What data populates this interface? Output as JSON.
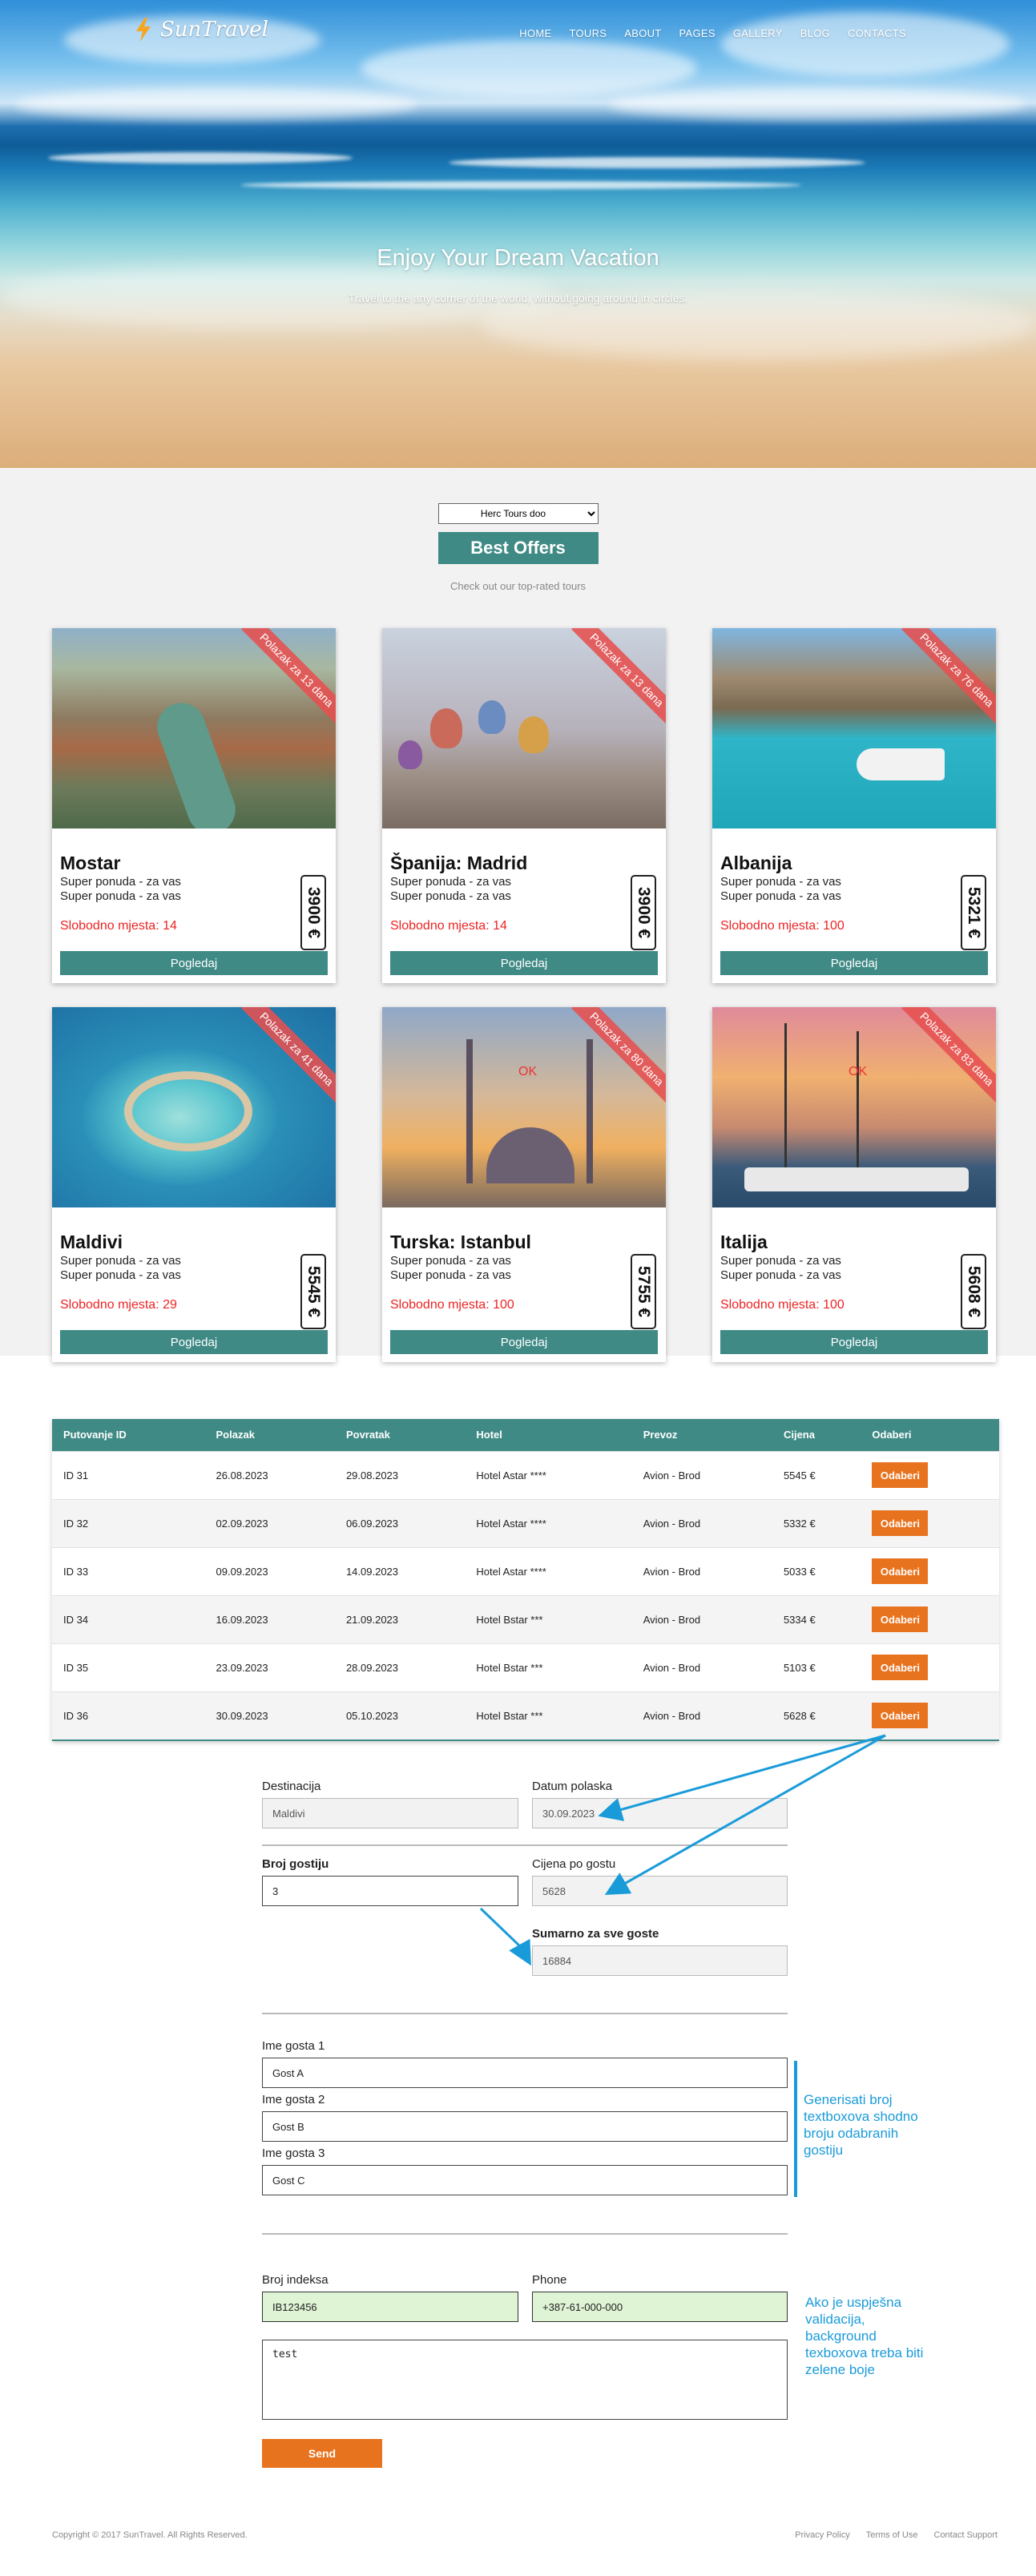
{
  "header": {
    "logo_text": "SunTravel",
    "nav": [
      "HOME",
      "TOURS",
      "ABOUT",
      "PAGES",
      "GALLERY",
      "BLOG",
      "CONTACTS"
    ],
    "title": "Enjoy Your Dream Vacation",
    "subtitle": "Travel to the any corner of the world, without going around in circles."
  },
  "offers": {
    "agency_selected": "Herc Tours doo",
    "title": "Best Offers",
    "subtitle": "Check out our top-rated tours",
    "cards": [
      {
        "title": "Mostar",
        "desc1": "Super ponuda - za vas",
        "desc2": "Super ponuda - za vas",
        "seats": "Slobodno mjesta: 14",
        "price": "3900 €",
        "ribbon": "Polazak za 13 dana",
        "ok": "",
        "button": "Pogledaj"
      },
      {
        "title": "Španija: Madrid",
        "desc1": "Super ponuda - za vas",
        "desc2": "Super ponuda - za vas",
        "seats": "Slobodno mjesta: 14",
        "price": "3900 €",
        "ribbon": "Polazak za 13 dana",
        "ok": "",
        "button": "Pogledaj"
      },
      {
        "title": "Albanija",
        "desc1": "Super ponuda - za vas",
        "desc2": "Super ponuda - za vas",
        "seats": "Slobodno mjesta: 100",
        "price": "5321 €",
        "ribbon": "Polazak za 76 dana",
        "ok": "",
        "button": "Pogledaj"
      },
      {
        "title": "Maldivi",
        "desc1": "Super ponuda - za vas",
        "desc2": "Super ponuda - za vas",
        "seats": "Slobodno mjesta: 29",
        "price": "5545 €",
        "ribbon": "Polazak za 41 dana",
        "ok": "",
        "button": "Pogledaj"
      },
      {
        "title": "Turska: Istanbul",
        "desc1": "Super ponuda - za vas",
        "desc2": "Super ponuda - za vas",
        "seats": "Slobodno mjesta: 100",
        "price": "5755 €",
        "ribbon": "Polazak za 80 dana",
        "ok": "OK",
        "button": "Pogledaj"
      },
      {
        "title": "Italija",
        "desc1": "Super ponuda - za vas",
        "desc2": "Super ponuda - za vas",
        "seats": "Slobodno mjesta: 100",
        "price": "5608 €",
        "ribbon": "Polazak za 83 dana",
        "ok": "OK",
        "button": "Pogledaj"
      }
    ]
  },
  "table": {
    "headers": [
      "Putovanje ID",
      "Polazak",
      "Povratak",
      "Hotel",
      "Prevoz",
      "Cijena",
      "Odaberi"
    ],
    "rows": [
      [
        "ID 31",
        "26.08.2023",
        "29.08.2023",
        "Hotel Astar ****",
        "Avion - Brod",
        "5545 €",
        "Odaberi"
      ],
      [
        "ID 32",
        "02.09.2023",
        "06.09.2023",
        "Hotel Astar ****",
        "Avion - Brod",
        "5332 €",
        "Odaberi"
      ],
      [
        "ID 33",
        "09.09.2023",
        "14.09.2023",
        "Hotel Astar ****",
        "Avion - Brod",
        "5033 €",
        "Odaberi"
      ],
      [
        "ID 34",
        "16.09.2023",
        "21.09.2023",
        "Hotel Bstar ***",
        "Avion - Brod",
        "5334 €",
        "Odaberi"
      ],
      [
        "ID 35",
        "23.09.2023",
        "28.09.2023",
        "Hotel Bstar ***",
        "Avion - Brod",
        "5103 €",
        "Odaberi"
      ],
      [
        "ID 36",
        "30.09.2023",
        "05.10.2023",
        "Hotel Bstar ***",
        "Avion - Brod",
        "5628 €",
        "Odaberi"
      ]
    ]
  },
  "form": {
    "destinacija_label": "Destinacija",
    "destinacija_value": "Maldivi",
    "datum_label": "Datum polaska",
    "datum_value": "30.09.2023",
    "broj_gostiju_label": "Broj gostiju",
    "broj_gostiju_value": "3",
    "cijena_label": "Cijena po gostu",
    "cijena_value": "5628",
    "sumarno_label": "Sumarno za sve goste",
    "sumarno_value": "16884",
    "guests": [
      {
        "label": "Ime gosta 1",
        "value": "Gost A"
      },
      {
        "label": "Ime gosta 2",
        "value": "Gost B"
      },
      {
        "label": "Ime gosta 3",
        "value": "Gost C"
      }
    ],
    "note_guests": "Generisati broj textboxova shodno broju odabranih gostiju",
    "indeks_label": "Broj indeksa",
    "indeks_value": "IB123456",
    "phone_label": "Phone",
    "phone_value": "+387-61-000-000",
    "note_validation": "Ako je uspješna validacija, background texboxova treba biti zelene boje",
    "textarea_value": "test",
    "send_label": "Send"
  },
  "footer": {
    "copyright": "Copyright © 2017 SunTravel. All Rights Reserved.",
    "links": [
      "Privacy Policy",
      "Terms of Use",
      "Contact Support"
    ]
  },
  "colors": {
    "accent_teal": "#3f8a85",
    "accent_orange": "#e8731f",
    "annotation_blue": "#1a9bd9",
    "valid_green": "#dff3d5"
  }
}
